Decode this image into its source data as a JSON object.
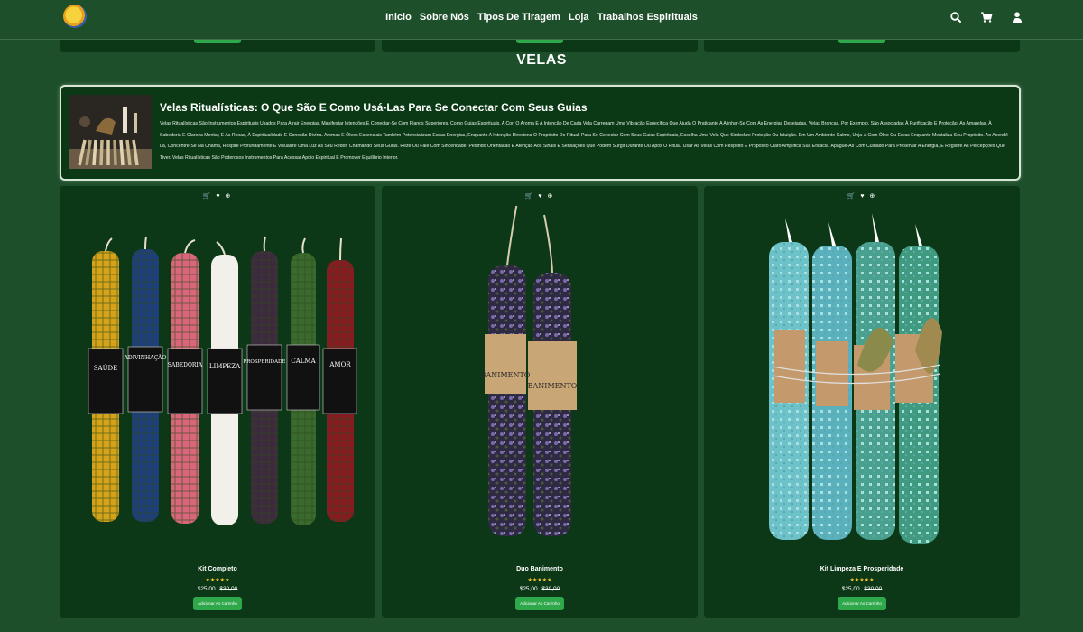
{
  "nav": {
    "items": [
      "Inicio",
      "Sobre Nós",
      "Tipos De Tiragem",
      "Loja",
      "Trabalhos Espirituais"
    ]
  },
  "section": {
    "title": "VELAS"
  },
  "info": {
    "title": "Velas Ritualísticas: O Que São E Como Usá-Las Para Se Conectar Com Seus Guias",
    "text": "Velas Ritualísticas São Instrumentos Espirituais Usados Para Atrair Energias, Manifestar Intenções E Conectar-Se Com Planos Superiores, Como Guias Espirituais. A Cor, O Aroma E A Intenção De Cada Vela Carregam Uma Vibração Específica Que Ajuda O Praticante A Alinhar-Se Com As Energias Desejadas. Velas Brancas, Por Exemplo, São Associadas À Purificação E Proteção; As Amarelas, À Sabedoria E Clareza Mental; E As Roxas, À Espiritualidade E Conexão Divina. Aromas E Óleos Essenciais Também Potencializam Essas Energias, Enquanto A Intenção Direciona O Propósito Do Ritual. Para Se Conectar Com Seus Guias Espirituais, Escolha Uma Vela Que Simbolize Proteção Ou Intuição. Em Um Ambiente Calmo, Unja-A Com Óleo Ou Ervas Enquanto Mentaliza Seu Propósito. Ao Acendê-La, Concentre-Se Na Chama, Respire Profundamente E Visualize Uma Luz As Seu Redor, Chamando Seus Guias. Reze Ou Fale Com Sinceridade, Pedindo Orientação E Atenção Aos Sinais E Sensações Que Podem Surgir Durante Ou Após O Ritual. Usar As Velas Com Respeito E Propósito Claro Amplifica Sua Eficácia. Apague-As Com Cuidado Para Preservar A Energia, E Registre As Percepções Que Tiver. Velas Ritualísticas São Poderosos Instrumentos Para Acessar Apoio Espiritual E Promover Equilíbrio Interior."
  },
  "card_icons": "🛒 ♥ ⊕",
  "products": [
    {
      "name": "Kit Completo",
      "stars": "★★★★★",
      "price": "$25,00",
      "old_price": "$30,00",
      "button": "Adicionar Ao Carrinho",
      "labels": [
        "SAÚDE",
        "ADIVINHAÇÃO",
        "SABEDORIA",
        "LIMPEZA",
        "PROSPERIDADE",
        "CALMA",
        "AMOR"
      ]
    },
    {
      "name": "Duo Banimento",
      "stars": "★★★★★",
      "price": "$25,00",
      "old_price": "$30,00",
      "button": "Adicionar Ao Carrinho",
      "labels": [
        "BANIMENTO",
        "BANIMENTO"
      ]
    },
    {
      "name": "Kit Limpeza E Prosperidade",
      "stars": "★★★★★",
      "price": "$25,00",
      "old_price": "$30,00",
      "button": "Adicionar Ao Carrinho",
      "labels": []
    }
  ],
  "colors": {
    "background": "#1d4f2a",
    "card": "#0c3817",
    "accent": "#2ea84a",
    "stars": "#f1c232"
  },
  "icons": [
    "search-icon",
    "cart-icon",
    "user-icon",
    "logo-sun-icon"
  ]
}
